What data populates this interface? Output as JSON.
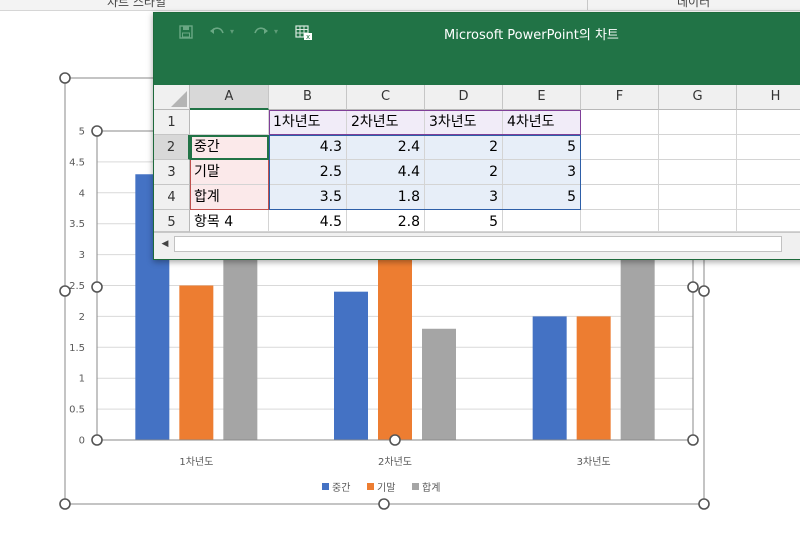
{
  "ribbon": {
    "chart_styles_label": "차트 스타일",
    "data_label": "데이터"
  },
  "datasheet": {
    "title": "Microsoft PowerPoint의 차트",
    "toolbar_icons": [
      "save-icon",
      "undo-icon",
      "redo-icon",
      "edit-data-in-excel-icon"
    ],
    "columns": [
      "A",
      "B",
      "C",
      "D",
      "E",
      "F",
      "G",
      "H"
    ],
    "rows": [
      "1",
      "2",
      "3",
      "4",
      "5"
    ],
    "header_row": [
      "",
      "1차년도",
      "2차년도",
      "3차년도",
      "4차년도"
    ],
    "data_rows": [
      [
        "중간",
        "4.3",
        "2.4",
        "2",
        "5"
      ],
      [
        "기말",
        "2.5",
        "4.4",
        "2",
        "3"
      ],
      [
        "합계",
        "3.5",
        "1.8",
        "3",
        "5"
      ],
      [
        "항목 4",
        "4.5",
        "2.8",
        "5",
        ""
      ]
    ],
    "colors": {
      "title_bar": "#217346",
      "category_highlight": "#c0504d",
      "series_highlight": "#7f3f98",
      "value_highlight": "#2e5fa8"
    }
  },
  "chart_data": {
    "type": "bar",
    "categories": [
      "1차년도",
      "2차년도",
      "3차년도"
    ],
    "series": [
      {
        "name": "중간",
        "color": "#4472c4",
        "values": [
          4.3,
          2.4,
          2
        ]
      },
      {
        "name": "기말",
        "color": "#ed7d31",
        "values": [
          2.5,
          4.4,
          2
        ]
      },
      {
        "name": "합계",
        "color": "#a5a5a5",
        "values": [
          3.5,
          1.8,
          3
        ]
      }
    ],
    "ylim": [
      0,
      5
    ],
    "yticks": [
      "0",
      "0.5",
      "1",
      "1.5",
      "2",
      "2.5",
      "3",
      "3.5",
      "4",
      "4.5",
      "5"
    ],
    "grid": true,
    "legend": "bottom",
    "title": "",
    "xlabel": "",
    "ylabel": ""
  }
}
